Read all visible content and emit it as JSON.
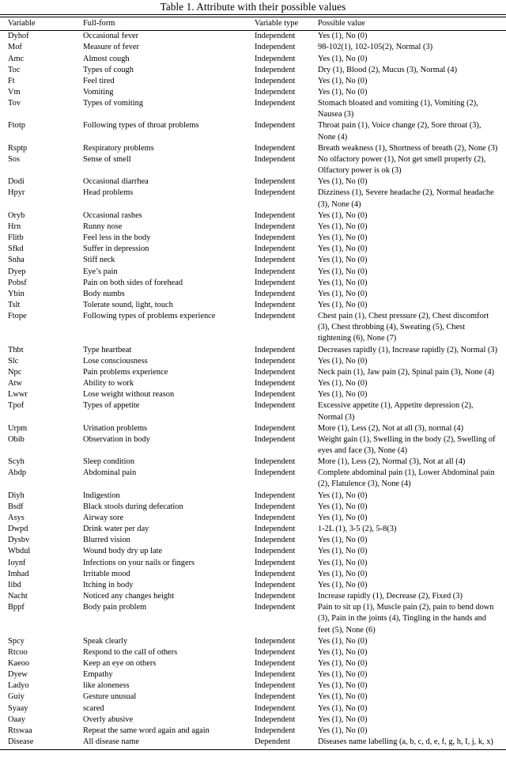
{
  "caption": "Table 1. Attribute with their possible values",
  "columns": {
    "variable": "Variable",
    "full_form": "Full-form",
    "variable_type": "Variable type",
    "possible_value": "Possible value"
  },
  "rows": [
    {
      "variable": "Dyhof",
      "full_form": "Occasional fever",
      "variable_type": "Independent",
      "possible_value": "Yes (1), No (0)"
    },
    {
      "variable": "Mof",
      "full_form": "Measure of fever",
      "variable_type": "Independent",
      "possible_value": "98-102(1), 102-105(2), Normal (3)"
    },
    {
      "variable": "Amc",
      "full_form": "Almost cough",
      "variable_type": "Independent",
      "possible_value": "Yes (1), No (0)"
    },
    {
      "variable": "Toc",
      "full_form": "Types of cough",
      "variable_type": "Independent",
      "possible_value": "Dry (1), Blood (2), Mucus (3), Normal (4)"
    },
    {
      "variable": "Ft",
      "full_form": "Feel tired",
      "variable_type": "Independent",
      "possible_value": "Yes (1), No (0)"
    },
    {
      "variable": "Vm",
      "full_form": "Vomiting",
      "variable_type": "Independent",
      "possible_value": "Yes (1), No (0)"
    },
    {
      "variable": "Tov",
      "full_form": "Types of vomiting",
      "variable_type": "Independent",
      "possible_value": "Stomach bloated and vomiting (1), Vomiting (2), Nausea (3)"
    },
    {
      "variable": "Ftotp",
      "full_form": "Following types of throat problems",
      "variable_type": "Independent",
      "possible_value": "Throat pain (1), Voice change (2), Sore throat (3), None (4)"
    },
    {
      "variable": "Rsptp",
      "full_form": "Respiratory problems",
      "variable_type": "Independent",
      "possible_value": "Breath weakness (1), Shortness of breath (2), None (3)"
    },
    {
      "variable": "Sos",
      "full_form": "Sense of smell",
      "variable_type": "Independent",
      "possible_value": "No olfactory power (1), Not get smell properly (2), Olfactory power is ok (3)"
    },
    {
      "variable": "Dodi",
      "full_form": "Occasional diarrhea",
      "variable_type": "Independent",
      "possible_value": "Yes (1), No (0)"
    },
    {
      "variable": "Hpyr",
      "full_form": "Head problems",
      "variable_type": "Independent",
      "possible_value": "Dizziness (1), Severe headache (2), Normal headache (3), None (4)"
    },
    {
      "variable": "Oryb",
      "full_form": "Occasional rashes",
      "variable_type": "Independent",
      "possible_value": "Yes (1), No (0)"
    },
    {
      "variable": "Hrn",
      "full_form": "Runny nose",
      "variable_type": "Independent",
      "possible_value": "Yes (1), No (0)"
    },
    {
      "variable": "Flitb",
      "full_form": "Feel less in the body",
      "variable_type": "Independent",
      "possible_value": "Yes (1), No (0)"
    },
    {
      "variable": "Sfkd",
      "full_form": "Suffer in depression",
      "variable_type": "Independent",
      "possible_value": "Yes (1), No (0)"
    },
    {
      "variable": "Snha",
      "full_form": "Stiff neck",
      "variable_type": "Independent",
      "possible_value": "Yes (1), No (0)"
    },
    {
      "variable": "Dyep",
      "full_form": "Eye’s pain",
      "variable_type": "Independent",
      "possible_value": "Yes (1), No (0)"
    },
    {
      "variable": "Pobsf",
      "full_form": "Pain on both sides of forehead",
      "variable_type": "Independent",
      "possible_value": "Yes (1), No (0)"
    },
    {
      "variable": "Ybin",
      "full_form": "Body numbs",
      "variable_type": "Independent",
      "possible_value": "Yes (1), No (0)"
    },
    {
      "variable": "Tslt",
      "full_form": "Tolerate sound, light, touch",
      "variable_type": "Independent",
      "possible_value": "Yes (1), No (0)"
    },
    {
      "variable": "Ftope",
      "full_form": "Following types of problems experience",
      "variable_type": "Independent",
      "possible_value": "Chest pain (1), Chest pressure (2), Chest discomfort (3), Chest throbbing (4), Sweating (5), Chest tightening (6), None (7)"
    },
    {
      "variable": "Thbt",
      "full_form": "Type heartbeat",
      "variable_type": "Independent",
      "possible_value": "Decreases rapidly (1), Increase rapidly (2), Normal (3)"
    },
    {
      "variable": "Slc",
      "full_form": "Lose consciousness",
      "variable_type": "Independent",
      "possible_value": "Yes (1), No (0)"
    },
    {
      "variable": "Npc",
      "full_form": "Pain problems experience",
      "variable_type": "Independent",
      "possible_value": "Neck pain (1), Jaw pain (2), Spinal pain (3), None (4)"
    },
    {
      "variable": "Atw",
      "full_form": "Ability to work",
      "variable_type": "Independent",
      "possible_value": "Yes (1), No (0)"
    },
    {
      "variable": "Lwwr",
      "full_form": "Lose weight without reason",
      "variable_type": "Independent",
      "possible_value": "Yes (1), No (0)"
    },
    {
      "variable": "Tpof",
      "full_form": "Types of appetite",
      "variable_type": "Independent",
      "possible_value": "Excessive appetite (1), Appetite depression (2), Normal (3)"
    },
    {
      "variable": "Urpm",
      "full_form": "Urination problems",
      "variable_type": "Independent",
      "possible_value": "More (1), Less (2), Not at all (3), normal (4)"
    },
    {
      "variable": "Obib",
      "full_form": "Observation in body",
      "variable_type": "Independent",
      "possible_value": "Weight gain (1), Swelling in the body (2), Swelling of eyes and face (3), None (4)"
    },
    {
      "variable": "Scyh",
      "full_form": "Sleep condition",
      "variable_type": "Independent",
      "possible_value": "More (1), Less (2), Normal (3), Not at all (4)"
    },
    {
      "variable": "Abdp",
      "full_form": "Abdominal pain",
      "variable_type": "Independent",
      "possible_value": "Complete abdominal pain (1), Lower Abdominal pain (2), Flatulence (3), None (4)"
    },
    {
      "variable": "Diyh",
      "full_form": "Indigestion",
      "variable_type": "Independent",
      "possible_value": "Yes (1), No (0)"
    },
    {
      "variable": "Bsdf",
      "full_form": "Black stools during defecation",
      "variable_type": "Independent",
      "possible_value": "Yes (1), No (0)"
    },
    {
      "variable": "Asys",
      "full_form": "Airway sore",
      "variable_type": "Independent",
      "possible_value": "Yes (1), No (0)"
    },
    {
      "variable": "Dwpd",
      "full_form": "Drink water per day",
      "variable_type": "Independent",
      "possible_value": "1-2L (1), 3-5 (2), 5-8(3)"
    },
    {
      "variable": "Dysbv",
      "full_form": "Blurred vision",
      "variable_type": "Independent",
      "possible_value": "Yes (1), No (0)"
    },
    {
      "variable": "Wbdul",
      "full_form": "Wound body dry up late",
      "variable_type": "Independent",
      "possible_value": "Yes (1), No (0)"
    },
    {
      "variable": "Ioynf",
      "full_form": "Infections on your nails or fingers",
      "variable_type": "Independent",
      "possible_value": "Yes (1), No (0)"
    },
    {
      "variable": "Imhad",
      "full_form": "Irritable mood",
      "variable_type": "Independent",
      "possible_value": "Yes (1), No (0)"
    },
    {
      "variable": "Iibd",
      "full_form": "Itching in body",
      "variable_type": "Independent",
      "possible_value": "Yes (1), No (0)"
    },
    {
      "variable": "Nacht",
      "full_form": "Noticed any changes height",
      "variable_type": "Independent",
      "possible_value": "Increase rapidly (1), Decrease (2), Fixed (3)"
    },
    {
      "variable": "Bppf",
      "full_form": "Body pain problem",
      "variable_type": "Independent",
      "possible_value": "Pain to sit up (1), Muscle pain (2), pain to bend down (3), Pain in the joints (4), Tingling in the hands and feet (5), None (6)"
    },
    {
      "variable": "Spcy",
      "full_form": "Speak clearly",
      "variable_type": "Independent",
      "possible_value": "Yes (1), No (0)"
    },
    {
      "variable": "Rtcoo",
      "full_form": "Respond to the call of others",
      "variable_type": "Independent",
      "possible_value": "Yes (1), No (0)"
    },
    {
      "variable": "Kaeoo",
      "full_form": "Keep an eye on others",
      "variable_type": "Independent",
      "possible_value": "Yes (1), No (0)"
    },
    {
      "variable": "Dyew",
      "full_form": "Empathy",
      "variable_type": "Independent",
      "possible_value": "Yes (1), No (0)"
    },
    {
      "variable": "Ladyo",
      "full_form": "like aloneness",
      "variable_type": "Independent",
      "possible_value": "Yes (1), No (0)"
    },
    {
      "variable": "Guiy",
      "full_form": "Gesture unusual",
      "variable_type": "Independent",
      "possible_value": "Yes (1), No (0)"
    },
    {
      "variable": "Syaay",
      "full_form": "scared",
      "variable_type": "Independent",
      "possible_value": "Yes (1), No (0)"
    },
    {
      "variable": "Oaay",
      "full_form": "Overly abusive",
      "variable_type": "Independent",
      "possible_value": "Yes (1), No (0)"
    },
    {
      "variable": "Rtswaa",
      "full_form": "Repeat the same word again and again",
      "variable_type": "Independent",
      "possible_value": "Yes (1), No (0)"
    },
    {
      "variable": "Disease",
      "full_form": "All disease name",
      "variable_type": "Dependent",
      "possible_value": "Diseases name labelling (a, b, c, d, e, f, g, h, I, j, k, x)"
    }
  ]
}
